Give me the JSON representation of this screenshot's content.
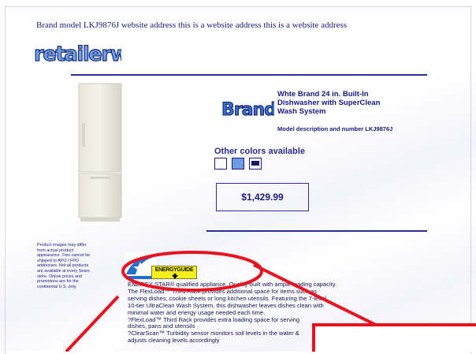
{
  "header": {
    "text": "Brand model LKJ9876J website address this is a website address this is a website address"
  },
  "logo": {
    "text": "retailerweb"
  },
  "product": {
    "image": "refrigerator-image",
    "brand_logo_text": "Brand",
    "title": "Whte Brand 24 in. Built-In Dishwasher with SuperClean Wash System",
    "model_description": "Model description and number LKJ9876J",
    "other_colors_label": "Other colors available",
    "swatches": [
      {
        "name": "white",
        "color": "#ffffff"
      },
      {
        "name": "light-blue",
        "color": "#6f9ae6"
      },
      {
        "name": "dark-navy",
        "color": "#1a1a60"
      }
    ],
    "price": "$1,429.99"
  },
  "disclaimer": "Product images may differ from actual product appearance. Tres cannot be shipped to APO / FPO addresses. Not all products are available at every Sears store. Online prices and promotions are for the continental U.S. only.",
  "badges": {
    "energy_star": "energy-star-logo",
    "energy_guide": "ENERGYGUIDE"
  },
  "description_lines": [
    "ENERGY STAR® qualified appliance. Quality-built with ample loading capacity.",
    "The FlexLoad™ Third Rack provides additional space for items such as",
    "serving dishes, cookie sheets or long kitchen utensils. Featuring the 7-level,",
    "10-tier UltraClean Wash System, this dishwasher leaves dishes clean with",
    "minimal water and energy usage needed each time.",
    "?FlexLoad™ Third Rack provides extra loading space for serving",
    "dishes, pans and utensils",
    "?ClearScan™ Turbidity sensor monitors soil levels in the water &",
    "adjusts cleaning levels accordingly"
  ],
  "colors": {
    "text_navy": "#1a1a80",
    "rule": "#2d2d96",
    "annotation_red": "#e8131f",
    "energy_yellow": "#f6ef1e"
  }
}
